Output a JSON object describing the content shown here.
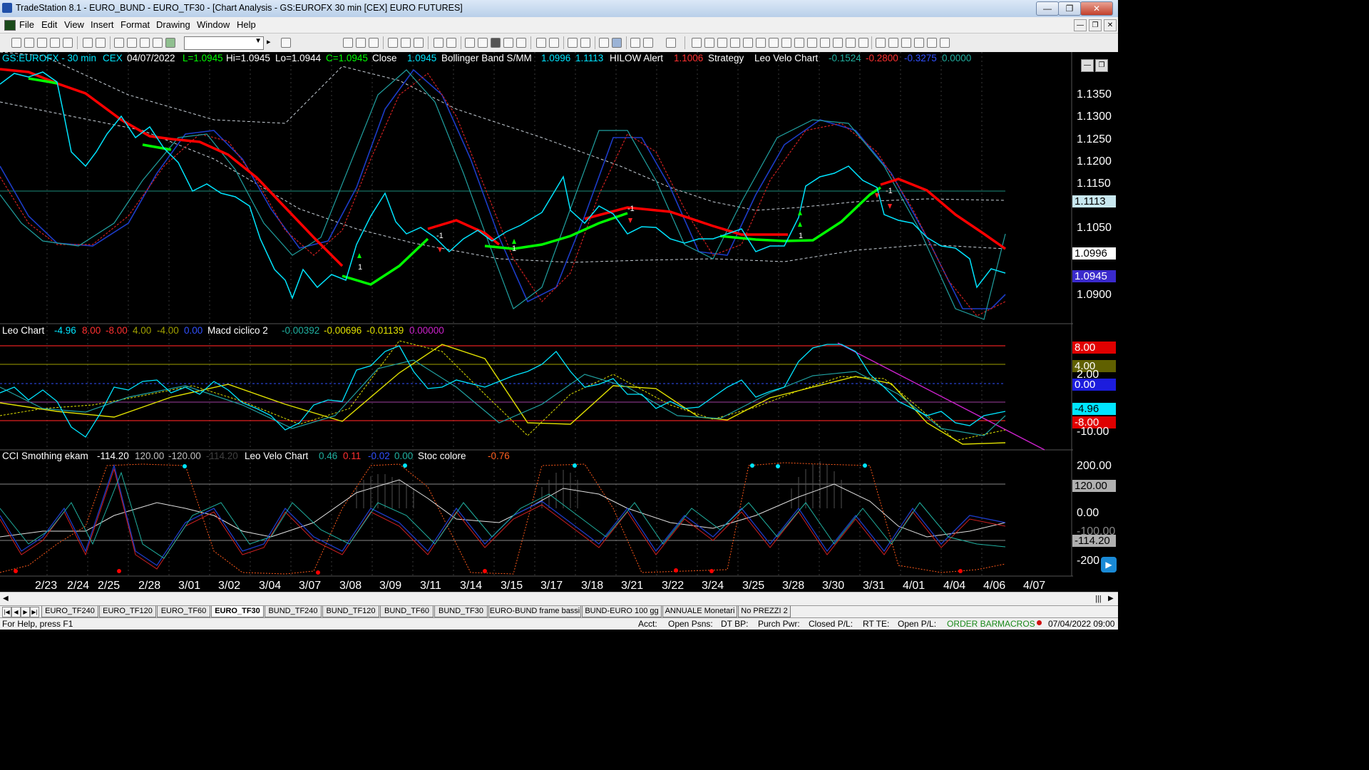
{
  "window": {
    "title": "TradeStation 8.1 - EURO_BUND - EURO_TF30 - [Chart Analysis - GS:EUROFX  30 min  [CEX] EURO FUTURES]"
  },
  "menu": {
    "items": [
      "File",
      "Edit",
      "View",
      "Insert",
      "Format",
      "Drawing",
      "Window",
      "Help"
    ]
  },
  "toolbar": {
    "symbol_value": ""
  },
  "header": {
    "symbol": "GS:EUROFX - 30 min",
    "exchange": "CEX",
    "date": "04/07/2022",
    "low": "L=1.0945",
    "high": "Hi=1.0945",
    "lo": "Lo=1.0944",
    "close_c": "C=1.0945",
    "close_label": "Close",
    "close_value": "1.0945",
    "bb_label": "Bollinger Band S/MM",
    "bb_lower": "1.0996",
    "bb_upper": "1.1113",
    "hilow_label": "HILOW Alert",
    "hilow_value": "1.1006",
    "strategy_label": "Strategy",
    "lvc_label": "Leo Velo Chart",
    "lvc1": "-0.1524",
    "lvc2": "-0.2800",
    "lvc3": "-0.3275",
    "lvc4": "0.0000"
  },
  "pane2": {
    "label": "Leo Chart",
    "v1": "-4.96",
    "v2": "8.00",
    "v3": "-8.00",
    "v4": "4.00",
    "v5": "-4.00",
    "v6": "0.00",
    "macd_label": "Macd ciclico 2",
    "m1": "-0.00392",
    "m2": "-0.00696",
    "m3": "-0.01139",
    "m4": "0.00000"
  },
  "pane3": {
    "label": "CCI Smothing ekam",
    "c1": "-114.20",
    "c2": "120.00",
    "c3": "-120.00",
    "c4": "-114.20",
    "lvc_label": "Leo Velo Chart",
    "l1": "0.46",
    "l2": "0.11",
    "l3": "-0.02",
    "l4": "0.00",
    "stoc_label": "Stoc colore",
    "s1": "-0.76"
  },
  "price_axis": {
    "ticks": [
      "1.1350",
      "1.1300",
      "1.1250",
      "1.1200",
      "1.1150",
      "1.1050",
      "1.0900"
    ],
    "tag_hilow": "1.1113",
    "tag_bb": "1.0996",
    "tag_close": "1.0945"
  },
  "leo_axis": {
    "t8": "8.00",
    "t4": "4.00",
    "t2": "2.00",
    "t0": "0.00",
    "tm": "-4.96",
    "tm8": "-8.00",
    "tm10": "-10.00"
  },
  "cci_axis": {
    "t200": "200.00",
    "t120": "120.00",
    "t0": "0.00",
    "tm100": "-100.00",
    "tm114": "-114.20",
    "tm200": "-200"
  },
  "dates": [
    "2/23",
    "2/24",
    "2/25",
    "2/28",
    "3/01",
    "3/02",
    "3/04",
    "3/07",
    "3/08",
    "3/09",
    "3/11",
    "3/14",
    "3/15",
    "3/17",
    "3/18",
    "3/21",
    "3/22",
    "3/24",
    "3/25",
    "3/28",
    "3/30",
    "3/31",
    "4/01",
    "4/04",
    "4/06",
    "4/07"
  ],
  "signals": {
    "one": "1",
    "minus_one": "-1"
  },
  "sheet_tabs": [
    "EURO_TF240",
    "EURO_TF120",
    "EURO_TF60",
    "EURO_TF30",
    "BUND_TF240",
    "BUND_TF120",
    "BUND_TF60",
    "BUND_TF30",
    "EURO-BUND frame bassi",
    "BUND-EURO 100 gg",
    "ANNUALE Monetari",
    "No PREZZI 2"
  ],
  "status": {
    "help": "For Help, press F1",
    "acct": "Acct:",
    "open_psns": "Open Psns:",
    "dt_bp": "DT BP:",
    "purch_pwr": "Purch Pwr:",
    "closed_pl": "Closed P/L:",
    "rt_te": "RT TE:",
    "open_pl": "Open P/L:",
    "order_bar": "ORDER BAR",
    "macros": "MACROS",
    "datetime": "07/04/2022 09:00"
  },
  "colors": {
    "bg": "#000000",
    "price": "#00e5ff",
    "ma_up": "#00ff00",
    "ma_down": "#ff0000",
    "blue": "#1c3cc8",
    "red_dash": "#d02020",
    "teal": "#20a0a0",
    "yellow": "#e0e000",
    "magenta": "#cc22cc"
  },
  "icons": [
    "app-icon",
    "new-icon",
    "open-icon",
    "save-icon",
    "print-icon",
    "zoom-in-icon",
    "zoom-out-icon",
    "pointer-icon",
    "arrow-up-icon",
    "arrow-down-icon",
    "clock-icon"
  ]
}
